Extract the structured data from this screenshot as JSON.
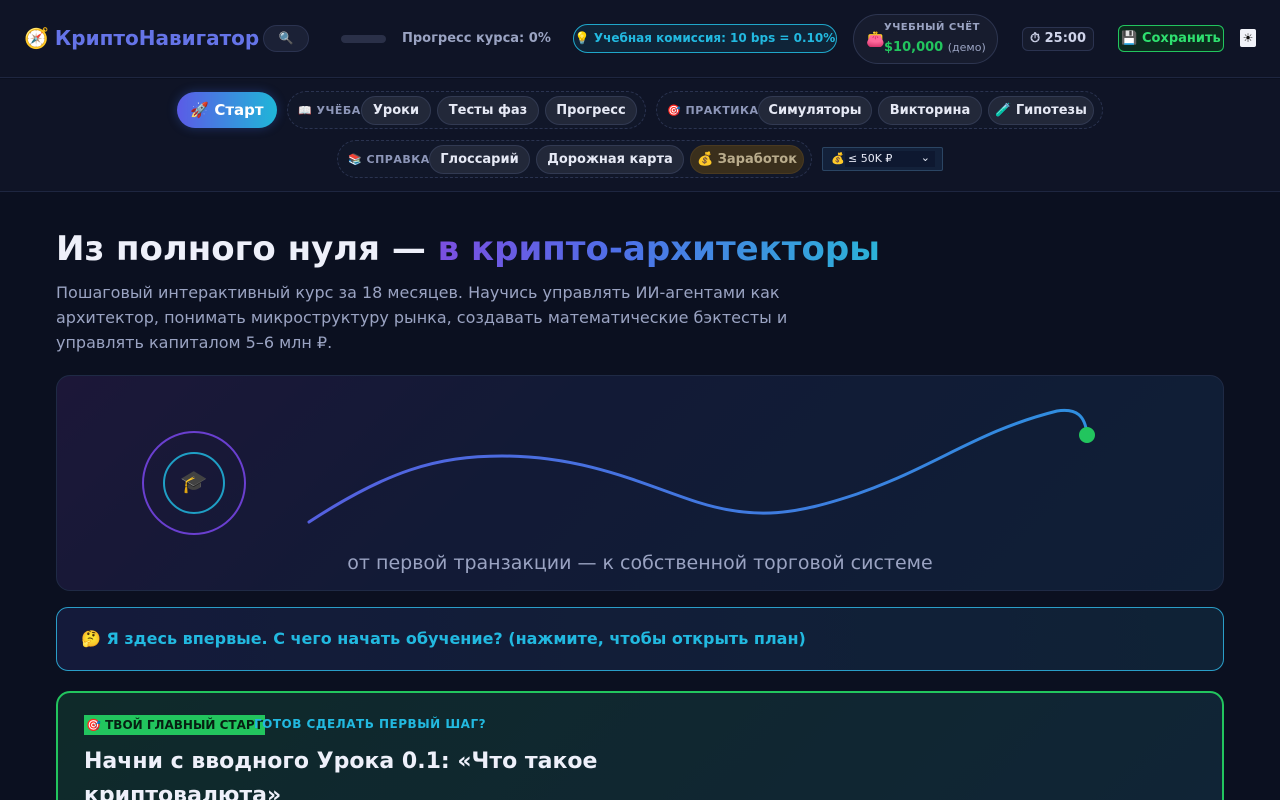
{
  "header": {
    "brand_icon": "compass-icon",
    "brand_glyph": "🧭",
    "brand_name": "КриптоНавигатор",
    "search_glyph": "🔍",
    "progress_label": "Прогресс курса: 0%",
    "progress_percent": 0,
    "commission_label": "💡 Учебная комиссия: 10 bps = 0.10%",
    "account_glyph": "👛",
    "account_label": "УЧЕБНЫЙ СЧЁТ",
    "account_value": "$10,000",
    "account_demo": "(демо)",
    "timer_label": "⏱ 25:00",
    "save_label": "💾 Сохранить",
    "theme_glyph": "☀"
  },
  "nav": {
    "start_label": "🚀 Старт",
    "groups": [
      {
        "label": "📖 УЧЁБА",
        "items": [
          "Уроки",
          "Тесты фаз",
          "Прогресс"
        ]
      },
      {
        "label": "🎯 ПРАКТИКА",
        "items": [
          "Симуляторы",
          "Викторина",
          "🧪 Гипотезы"
        ]
      },
      {
        "label": "📚 СПРАВКА",
        "items": [
          "Глоссарий",
          "Дорожная карта",
          "💰 Заработок"
        ]
      }
    ],
    "budget_glyph": "💰",
    "budget_value": "≤ 50K ₽"
  },
  "hero": {
    "title_plain": "Из полного нуля — ",
    "title_accent": "в крипто-архитекторы",
    "subtitle": "Пошаговый интерактивный курс за 18 месяцев. Научись управлять ИИ-агентами как архитектор, понимать микроструктуру рынка, создавать математические бэктесты и управлять капиталом 5–6 млн ₽.",
    "ring_glyph": "🎓",
    "caption": "от первой транзакции — к собственной торговой системе"
  },
  "first_time": {
    "label": "🤔 Я здесь впервые. С чего начать обучение? (нажмите, чтобы открыть план)"
  },
  "start_card": {
    "badge": "🎯 ТВОЙ ГЛАВНЫЙ СТАРТ",
    "kicker": "ГОТОВ СДЕЛАТЬ ПЕРВЫЙ ШАГ?",
    "title": "Начни с вводного Урока 0.1: «Что такое криптовалюта»"
  },
  "colors": {
    "accent": "#6574e8",
    "success": "#22c55e",
    "info": "#22b9e0"
  }
}
